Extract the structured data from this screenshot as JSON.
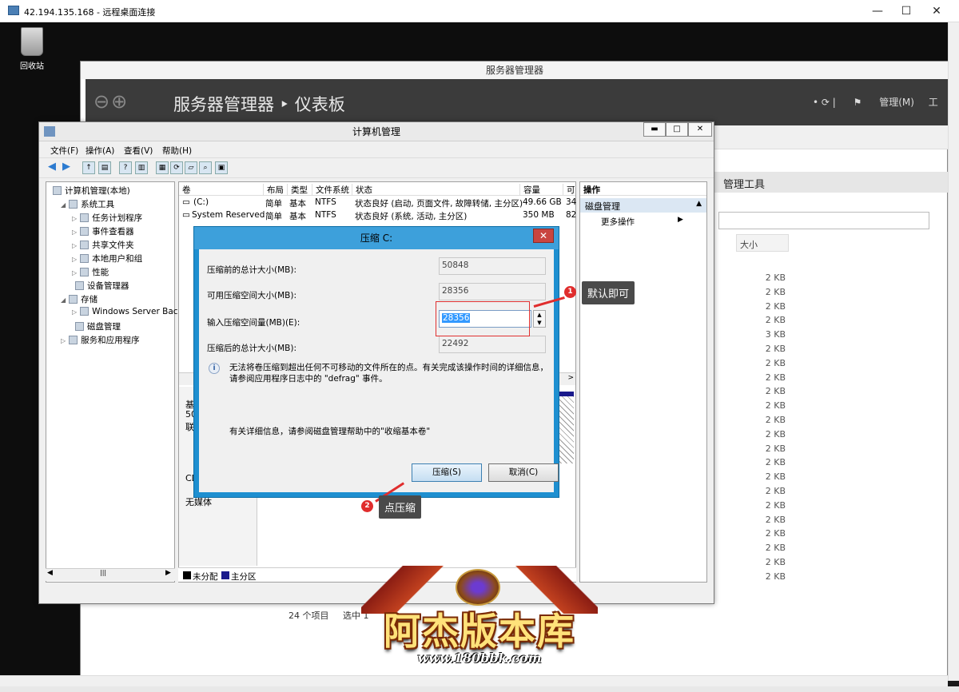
{
  "rdp": {
    "title": "42.194.135.168 - 远程桌面连接",
    "minimize": "—",
    "maximize": "☐",
    "close": "✕"
  },
  "desktop": {
    "recycle_bin": "回收站"
  },
  "server_manager": {
    "title": "服务器管理器",
    "breadcrumb": "服务器管理器 ‣ 仪表板",
    "manage_menu": "管理(M)",
    "tools_label": "工",
    "tools_bar": "管理工具",
    "size_header": "大小",
    "sizes": [
      "2 KB",
      "2 KB",
      "2 KB",
      "2 KB",
      "3 KB",
      "2 KB",
      "2 KB",
      "2 KB",
      "2 KB",
      "2 KB",
      "2 KB",
      "2 KB",
      "2 KB",
      "2 KB",
      "2 KB",
      "2 KB",
      "2 KB",
      "2 KB",
      "2 KB",
      "2 KB",
      "2 KB",
      "2 KB"
    ],
    "status_count": "24 个项目",
    "status_selected": "选中 1",
    "windows_text": "Windows"
  },
  "computer_mgmt": {
    "title": "计算机管理",
    "menu": [
      "文件(F)",
      "操作(A)",
      "查看(V)",
      "帮助(H)"
    ],
    "tree": [
      {
        "label": "计算机管理(本地)",
        "level": 0,
        "expander": ""
      },
      {
        "label": "系统工具",
        "level": 1,
        "expander": "◢"
      },
      {
        "label": "任务计划程序",
        "level": 2,
        "expander": "▷"
      },
      {
        "label": "事件查看器",
        "level": 2,
        "expander": "▷"
      },
      {
        "label": "共享文件夹",
        "level": 2,
        "expander": "▷"
      },
      {
        "label": "本地用户和组",
        "level": 2,
        "expander": "▷"
      },
      {
        "label": "性能",
        "level": 2,
        "expander": "▷"
      },
      {
        "label": "设备管理器",
        "level": 2,
        "expander": ""
      },
      {
        "label": "存储",
        "level": 1,
        "expander": "◢"
      },
      {
        "label": "Windows Server Back",
        "level": 2,
        "expander": "▷"
      },
      {
        "label": "磁盘管理",
        "level": 2,
        "expander": ""
      },
      {
        "label": "服务和应用程序",
        "level": 1,
        "expander": "▷"
      }
    ],
    "columns": [
      "卷",
      "布局",
      "类型",
      "文件系统",
      "状态",
      "容量",
      "可"
    ],
    "volumes": [
      {
        "name": "(C:)",
        "layout": "简单",
        "type": "基本",
        "fs": "NTFS",
        "status": "状态良好 (启动, 页面文件, 故障转储, 主分区)",
        "capacity": "49.66 GB",
        "free": "34"
      },
      {
        "name": "System Reserved",
        "layout": "简单",
        "type": "基本",
        "fs": "NTFS",
        "status": "状态良好 (系统, 活动, 主分区)",
        "capacity": "350 MB",
        "free": "82"
      }
    ],
    "disk_labels": [
      "基",
      "50",
      "联",
      "CD",
      "无媒体"
    ],
    "legend": [
      {
        "label": "未分配",
        "color": "#000000"
      },
      {
        "label": "主分区",
        "color": "#1a1a8c"
      }
    ],
    "actions_header": "操作",
    "actions_section": "磁盘管理",
    "actions_more": "更多操作"
  },
  "shrink_dialog": {
    "title": "压缩 C:",
    "close": "✕",
    "fields": [
      {
        "label": "压缩前的总计大小(MB):",
        "value": "50848"
      },
      {
        "label": "可用压缩空间大小(MB):",
        "value": "28356"
      },
      {
        "label": "输入压缩空间量(MB)(E):",
        "value": "28356"
      },
      {
        "label": "压缩后的总计大小(MB):",
        "value": "22492"
      }
    ],
    "info_text": "无法将卷压缩到超出任何不可移动的文件所在的点。有关完成该操作时间的详细信息，请参阅应用程序日志中的 \"defrag\" 事件。",
    "detail_text": "有关详细信息，请参阅磁盘管理帮助中的\"收缩基本卷\"",
    "shrink_button": "压缩(S)",
    "cancel_button": "取消(C)"
  },
  "annotations": {
    "step1_number": "1",
    "step1_text": "默认即可",
    "step2_number": "2",
    "step2_text": "点压缩",
    "color": "#e02d2d"
  },
  "watermark": {
    "title": "阿杰版本库",
    "url": "www.180bbk.com"
  }
}
